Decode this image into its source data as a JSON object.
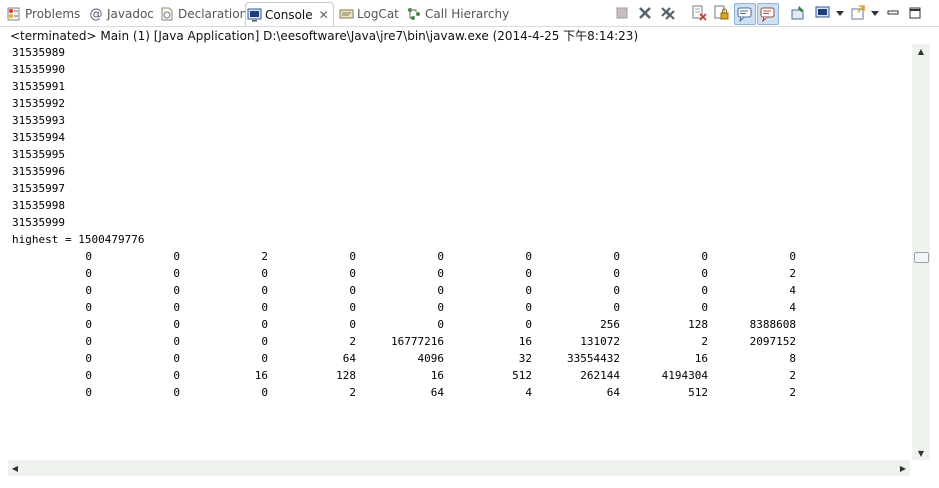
{
  "tabs": [
    {
      "label": "Problems",
      "icon": "problems-icon"
    },
    {
      "label": "Javadoc",
      "icon": "at-icon"
    },
    {
      "label": "Declaration",
      "icon": "declaration-icon"
    },
    {
      "label": "Console",
      "icon": "console-icon",
      "active": true
    },
    {
      "label": "LogCat",
      "icon": "logcat-icon"
    },
    {
      "label": "Call Hierarchy",
      "icon": "call-hierarchy-icon"
    }
  ],
  "toolbar": [
    "terminate-icon",
    "remove-launch-icon",
    "remove-all-terminated-icon",
    "clear-console-icon",
    "scroll-lock-icon",
    "show-on-stdout-icon",
    "show-on-stderr-icon",
    "pin-console-icon",
    "display-console-icon",
    "open-console-icon",
    "minimize-icon",
    "maximize-icon"
  ],
  "status": "<terminated> Main (1) [Java Application] D:\\eesoftware\\Java\\jre7\\bin\\javaw.exe (2014-4-25 下午8:14:23)",
  "console": {
    "numbers": [
      "31535989",
      "31535990",
      "31535991",
      "31535992",
      "31535993",
      "31535994",
      "31535995",
      "31535996",
      "31535997",
      "31535998",
      "31535999"
    ],
    "highest": "highest = 1500479776",
    "table": [
      [
        "0",
        "0",
        "2",
        "0",
        "0",
        "0",
        "0",
        "0",
        "0"
      ],
      [
        "0",
        "0",
        "0",
        "0",
        "0",
        "0",
        "0",
        "0",
        "2"
      ],
      [
        "0",
        "0",
        "0",
        "0",
        "0",
        "0",
        "0",
        "0",
        "4"
      ],
      [
        "0",
        "0",
        "0",
        "0",
        "0",
        "0",
        "0",
        "0",
        "4"
      ],
      [
        "0",
        "0",
        "0",
        "0",
        "0",
        "0",
        "256",
        "128",
        "8388608"
      ],
      [
        "0",
        "0",
        "0",
        "2",
        "16777216",
        "16",
        "131072",
        "2",
        "2097152"
      ],
      [
        "0",
        "0",
        "0",
        "64",
        "4096",
        "32",
        "33554432",
        "16",
        "8"
      ],
      [
        "0",
        "0",
        "16",
        "128",
        "16",
        "512",
        "262144",
        "4194304",
        "2"
      ],
      [
        "0",
        "0",
        "0",
        "2",
        "64",
        "4",
        "64",
        "512",
        "2"
      ]
    ]
  },
  "colors": {
    "scrollbar": "#eef3ee",
    "active_tab_border": "#c7ccd3"
  }
}
